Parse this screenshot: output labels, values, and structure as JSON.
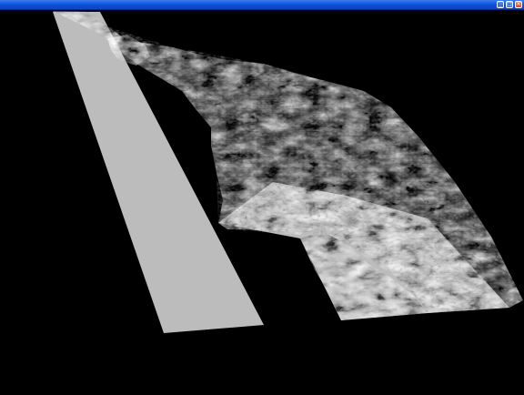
{
  "window": {
    "title": "",
    "buttons": {
      "minimize_glyph": "_",
      "maximize_glyph": "□",
      "close_glyph": "×"
    },
    "colors": {
      "titlebar": "#0a4fd8",
      "background": "#000000",
      "plane": "#bcbcbc"
    }
  },
  "scene": {
    "type": "3d-terrain-render",
    "shading": "grayscale"
  }
}
